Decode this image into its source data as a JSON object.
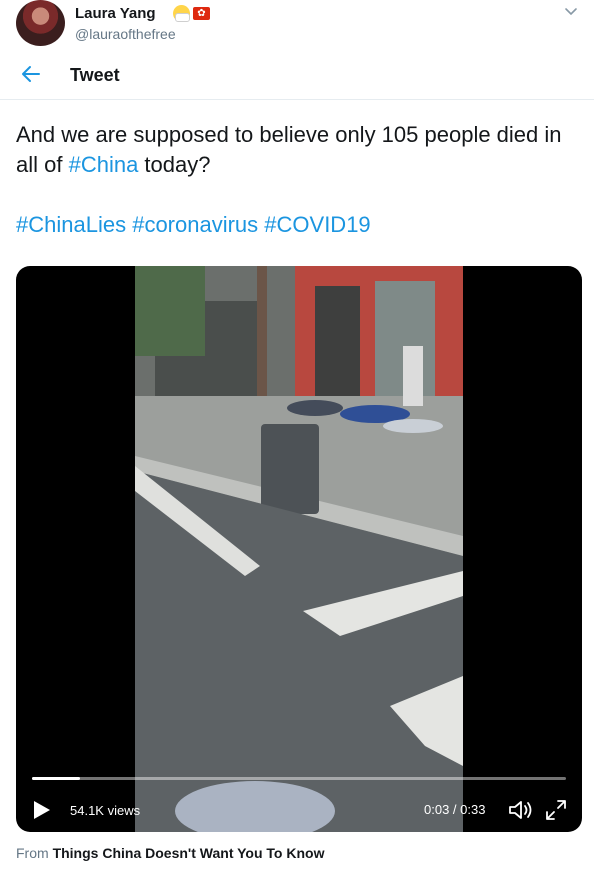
{
  "author": {
    "name": "Laura Yang",
    "handle": "@lauraofthefree",
    "emoji_icons": [
      "medical-mask-face-icon",
      "hong-kong-flag-icon"
    ]
  },
  "header": {
    "title": "Tweet",
    "back_icon": "back-arrow-icon"
  },
  "tweet": {
    "line1_pre": "And we are supposed to believe only 105 people died in all of ",
    "line1_tag": "#China",
    "line1_post": " today?",
    "hashtags": [
      "#ChinaLies",
      "#coronavirus",
      "#COVID19"
    ]
  },
  "video": {
    "views": "54.1K views",
    "time": "0:03 / 0:33",
    "progress": 0.09
  },
  "source": {
    "prefix": "From",
    "name": "Things China Doesn't Want You To Know"
  },
  "colors": {
    "link": "#1b95e0",
    "text": "#14171a",
    "muted": "#657786",
    "divider": "#e6ecf0"
  }
}
